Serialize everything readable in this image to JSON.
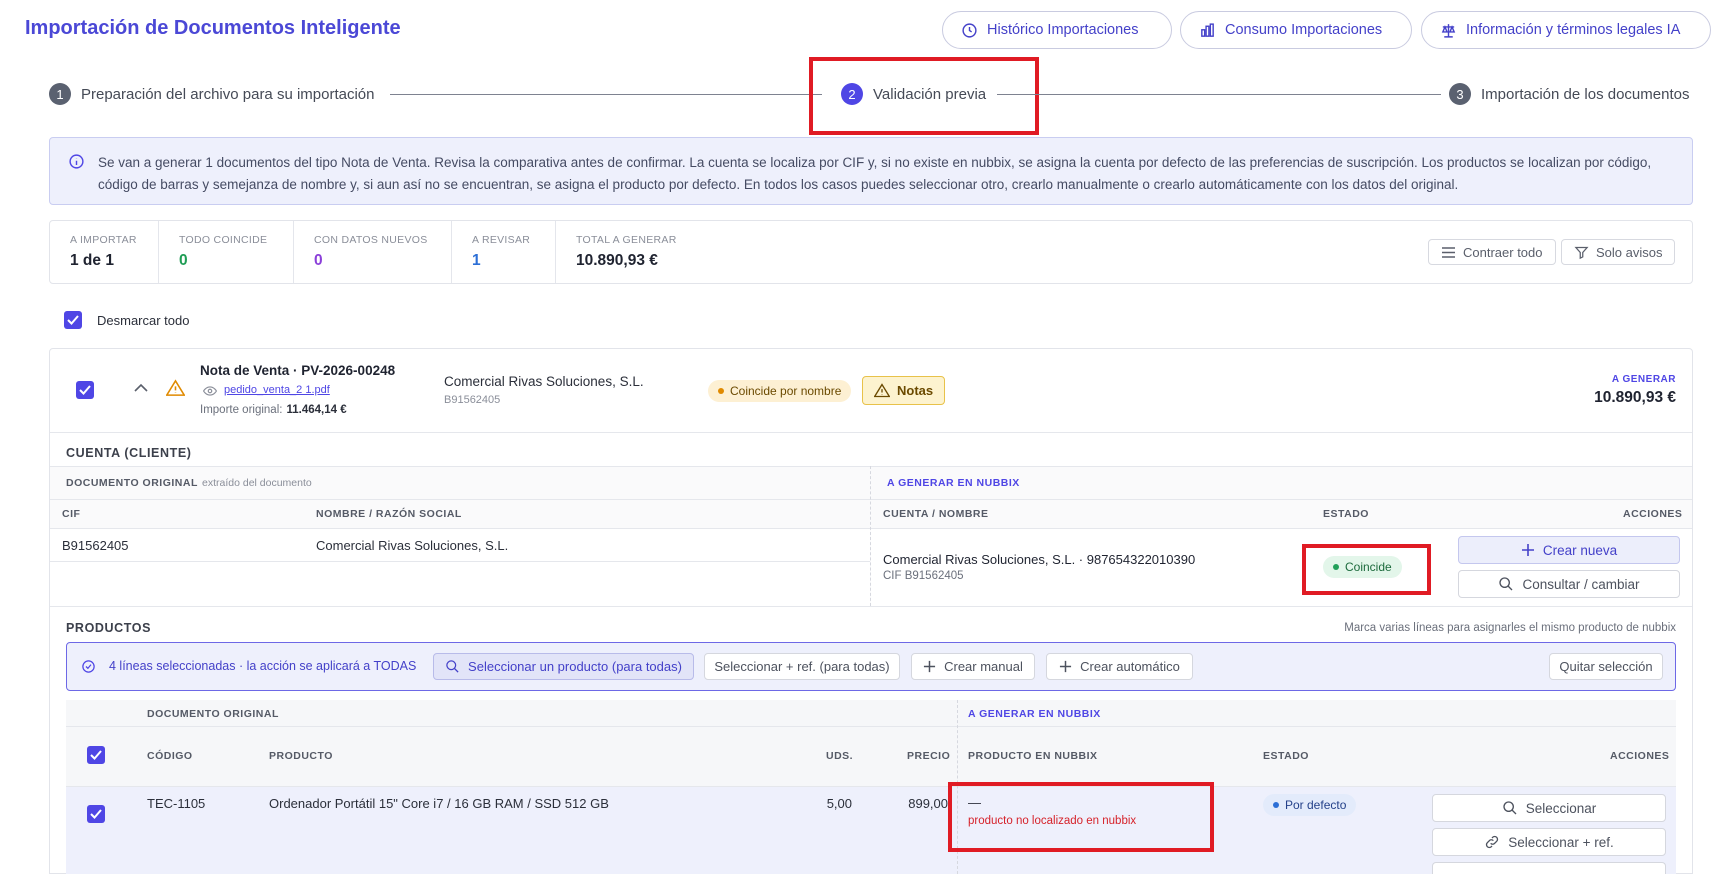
{
  "header": {
    "title": "Importación de Documentos Inteligente",
    "buttons": [
      {
        "label": "Histórico Importaciones",
        "icon": "clock-icon"
      },
      {
        "label": "Consumo Importaciones",
        "icon": "bar-chart-icon"
      },
      {
        "label": "Información y términos legales IA",
        "icon": "scale-icon"
      }
    ]
  },
  "stepper": {
    "steps": [
      {
        "number": "1",
        "label": "Preparación del archivo para su importación"
      },
      {
        "number": "2",
        "label": "Validación previa",
        "active": true
      },
      {
        "number": "3",
        "label": "Importación de los documentos"
      }
    ]
  },
  "info": {
    "text": "Se van a generar 1 documentos del tipo Nota de Venta. Revisa la comparativa antes de confirmar. La cuenta se localiza por CIF y, si no existe en nubbix, se asigna la cuenta por defecto de las preferencias de suscripción. Los productos se localizan por código, código de barras y semejanza de nombre y, si aun así no se encuentran, se asigna el producto por defecto. En todos los casos puedes seleccionar otro, crearlo manualmente o crearlo automáticamente con los datos del original."
  },
  "stats": {
    "items": [
      {
        "label": "A importar",
        "value": "1 de 1",
        "color": "#1f2330"
      },
      {
        "label": "Todo coincide",
        "value": "0",
        "color": "#1f9d55"
      },
      {
        "label": "Con datos nuevos",
        "value": "0",
        "color": "#8b3fd9"
      },
      {
        "label": "A revisar",
        "value": "1",
        "color": "#2c6fd6"
      },
      {
        "label": "Total a generar",
        "value": "10.890,93 €",
        "color": "#1f2330"
      }
    ],
    "collapse_label": "Contraer todo",
    "filter_label": "Solo avisos"
  },
  "select_all_label": "Desmarcar todo",
  "document": {
    "title": "Nota de Venta · PV-2026-00248",
    "file": "pedido_venta_2 1.pdf",
    "original_amount_label": "Importe original:",
    "original_amount": "11.464,14 €",
    "client_name": "Comercial Rivas Soluciones, S.L.",
    "client_cif": "B91562405",
    "match_badge": "Coincide por nombre",
    "notes_badge": "Notas",
    "generate_label": "A GENERAR",
    "generate_total": "10.890,93 €"
  },
  "account": {
    "section_title": "CUENTA (CLIENTE)",
    "original_header": "DOCUMENTO ORIGINAL",
    "original_sub": "extraído del documento",
    "generate_header": "A GENERAR EN NUBBIX",
    "columns": {
      "cif": "CIF",
      "name": "NOMBRE / RAZÓN SOCIAL",
      "account": "CUENTA / NOMBRE",
      "status": "ESTADO",
      "actions": "ACCIONES"
    },
    "row": {
      "cif": "B91562405",
      "name": "Comercial Rivas Soluciones, S.L.",
      "account_name": "Comercial Rivas Soluciones, S.L. · 987654322010390",
      "account_cif": "CIF B91562405",
      "status": "Coincide",
      "create_label": "Crear nueva",
      "consult_label": "Consultar / cambiar"
    }
  },
  "products": {
    "section_title": "PRODUCTOS",
    "hint": "Marca varias líneas para asignarles el mismo producto de nubbix",
    "bulk": {
      "text": "4 líneas seleccionadas · la acción se aplicará a TODAS",
      "select_all": "Seleccionar un producto (para todas)",
      "select_ref_all": "Seleccionar + ref. (para todas)",
      "create_manual": "Crear manual",
      "create_auto": "Crear automático",
      "clear": "Quitar selección"
    },
    "original_header": "DOCUMENTO ORIGINAL",
    "generate_header": "A GENERAR EN NUBBIX",
    "columns": {
      "code": "CÓDIGO",
      "product": "PRODUCTO",
      "units": "UDS.",
      "price": "PRECIO",
      "nubbix": "PRODUCTO EN NUBBIX",
      "status": "ESTADO",
      "actions": "ACCIONES"
    },
    "row": {
      "code": "TEC-1105",
      "product": "Ordenador Portátil 15\" Core i7 / 16 GB RAM / SSD 512 GB",
      "units": "5,00",
      "price": "899,00",
      "nubbix_value": "—",
      "nubbix_note": "producto no localizado en nubbix",
      "status": "Por defecto",
      "select_label": "Seleccionar",
      "select_ref_label": "Seleccionar + ref."
    }
  }
}
